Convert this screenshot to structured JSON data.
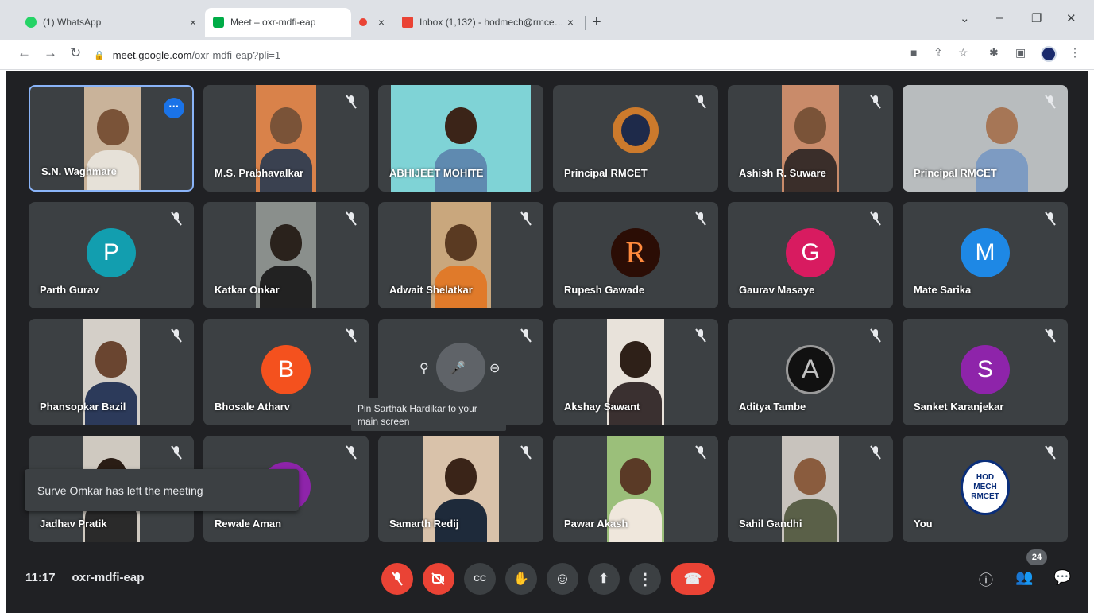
{
  "browser": {
    "tabs": [
      {
        "label": "(1) WhatsApp",
        "favicon_color": "#25d366",
        "active": false
      },
      {
        "label": "Meet – oxr-mdfi-eap",
        "favicon_color": "#00ac47",
        "active": true
      },
      {
        "label": "",
        "favicon_color": "#ea4335",
        "active": false
      },
      {
        "label": "Inbox (1,132) - hodmech@rmce…",
        "favicon_color": "#ea4335",
        "active": false
      }
    ],
    "tab_close_glyph": "×",
    "new_tab_glyph": "+",
    "window_controls": {
      "dropdown": "⌄",
      "minimize": "–",
      "restore": "❐",
      "close": "✕"
    },
    "nav": {
      "back": "←",
      "forward": "→",
      "reload": "↻"
    },
    "url_host": "meet.google.com",
    "url_path": "/oxr-mdfi-eap?pli=1"
  },
  "meeting": {
    "time": "11:17",
    "code": "oxr-mdfi-eap",
    "participant_count": "24",
    "toast": "Surve Omkar has left the meeting",
    "tooltip": "Pin Sarthak Hardikar to your main screen",
    "hover_controls": {
      "pin": "⚲",
      "mute": "🎤",
      "remove": "⊖"
    },
    "participants": [
      {
        "name": "S.N. Waghmare",
        "type": "video",
        "bg": "#c9b39a",
        "active": true
      },
      {
        "name": "M.S. Prabhavalkar",
        "type": "video",
        "bg": "#d9824a"
      },
      {
        "name": "ABHIJEET MOHITE",
        "type": "video",
        "bg": "#7fd3d6"
      },
      {
        "name": "Principal RMCET",
        "type": "photo",
        "bg": "#3c4043"
      },
      {
        "name": "Ashish R. Suware",
        "type": "video",
        "bg": "#c98b6a"
      },
      {
        "name": "Principal RMCET",
        "type": "video",
        "bg": "#b8bcbe"
      },
      {
        "name": "Parth Gurav",
        "type": "avatar",
        "initial": "P",
        "color": "#129eaf"
      },
      {
        "name": "Katkar Onkar",
        "type": "video",
        "bg": "#8a8f8c"
      },
      {
        "name": "Adwait Shelatkar",
        "type": "video",
        "bg": "#c9a77d"
      },
      {
        "name": "Rupesh Gawade",
        "type": "avatar",
        "initial": "R",
        "color": "#2b0d05"
      },
      {
        "name": "Gaurav Masaye",
        "type": "avatar",
        "initial": "G",
        "color": "#d81b60"
      },
      {
        "name": "Mate Sarika",
        "type": "avatar",
        "initial": "M",
        "color": "#1e88e5"
      },
      {
        "name": "Phansopkar Bazil",
        "type": "video",
        "bg": "#d4cfc8"
      },
      {
        "name": "Bhosale Atharv",
        "type": "avatar",
        "initial": "B",
        "color": "#f4511e"
      },
      {
        "name": "",
        "type": "hover",
        "bg": "#3c4043"
      },
      {
        "name": "Akshay Sawant",
        "type": "video",
        "bg": "#e8e2da"
      },
      {
        "name": "Aditya Tambe",
        "type": "avatar",
        "initial": "A",
        "color": "#111111"
      },
      {
        "name": "Sanket Karanjekar",
        "type": "avatar",
        "initial": "S",
        "color": "#8e24aa"
      },
      {
        "name": "Jadhav Pratik",
        "type": "video",
        "bg": "#cfc9c0"
      },
      {
        "name": "Rewale Aman",
        "type": "avatar",
        "initial": "",
        "color": "#8e24aa"
      },
      {
        "name": "Samarth Redij",
        "type": "video",
        "bg": "#d9c2aa"
      },
      {
        "name": "Pawar Akash",
        "type": "video",
        "bg": "#9bbf7a"
      },
      {
        "name": "Sahil Gandhi",
        "type": "video",
        "bg": "#c8c3bd"
      },
      {
        "name": "You",
        "type": "logo",
        "logo_lines": [
          "HOD",
          "MECH",
          "RMCET"
        ]
      }
    ],
    "controls": [
      {
        "name": "mic-off-button",
        "glyph": "🎙",
        "style": "red"
      },
      {
        "name": "camera-off-button",
        "glyph": "⊘",
        "style": "red"
      },
      {
        "name": "captions-button",
        "glyph": "CC",
        "style": "dark"
      },
      {
        "name": "raise-hand-button",
        "glyph": "✋",
        "style": "dark"
      },
      {
        "name": "reactions-button",
        "glyph": "☺",
        "style": "dark"
      },
      {
        "name": "present-button",
        "glyph": "⬆",
        "style": "dark"
      },
      {
        "name": "more-options-button",
        "glyph": "⋮",
        "style": "dark"
      },
      {
        "name": "hang-up-button",
        "glyph": "☎",
        "style": "hangup"
      }
    ],
    "right_controls": {
      "info": "ⓘ",
      "people": "👥",
      "chat": "💬"
    }
  }
}
